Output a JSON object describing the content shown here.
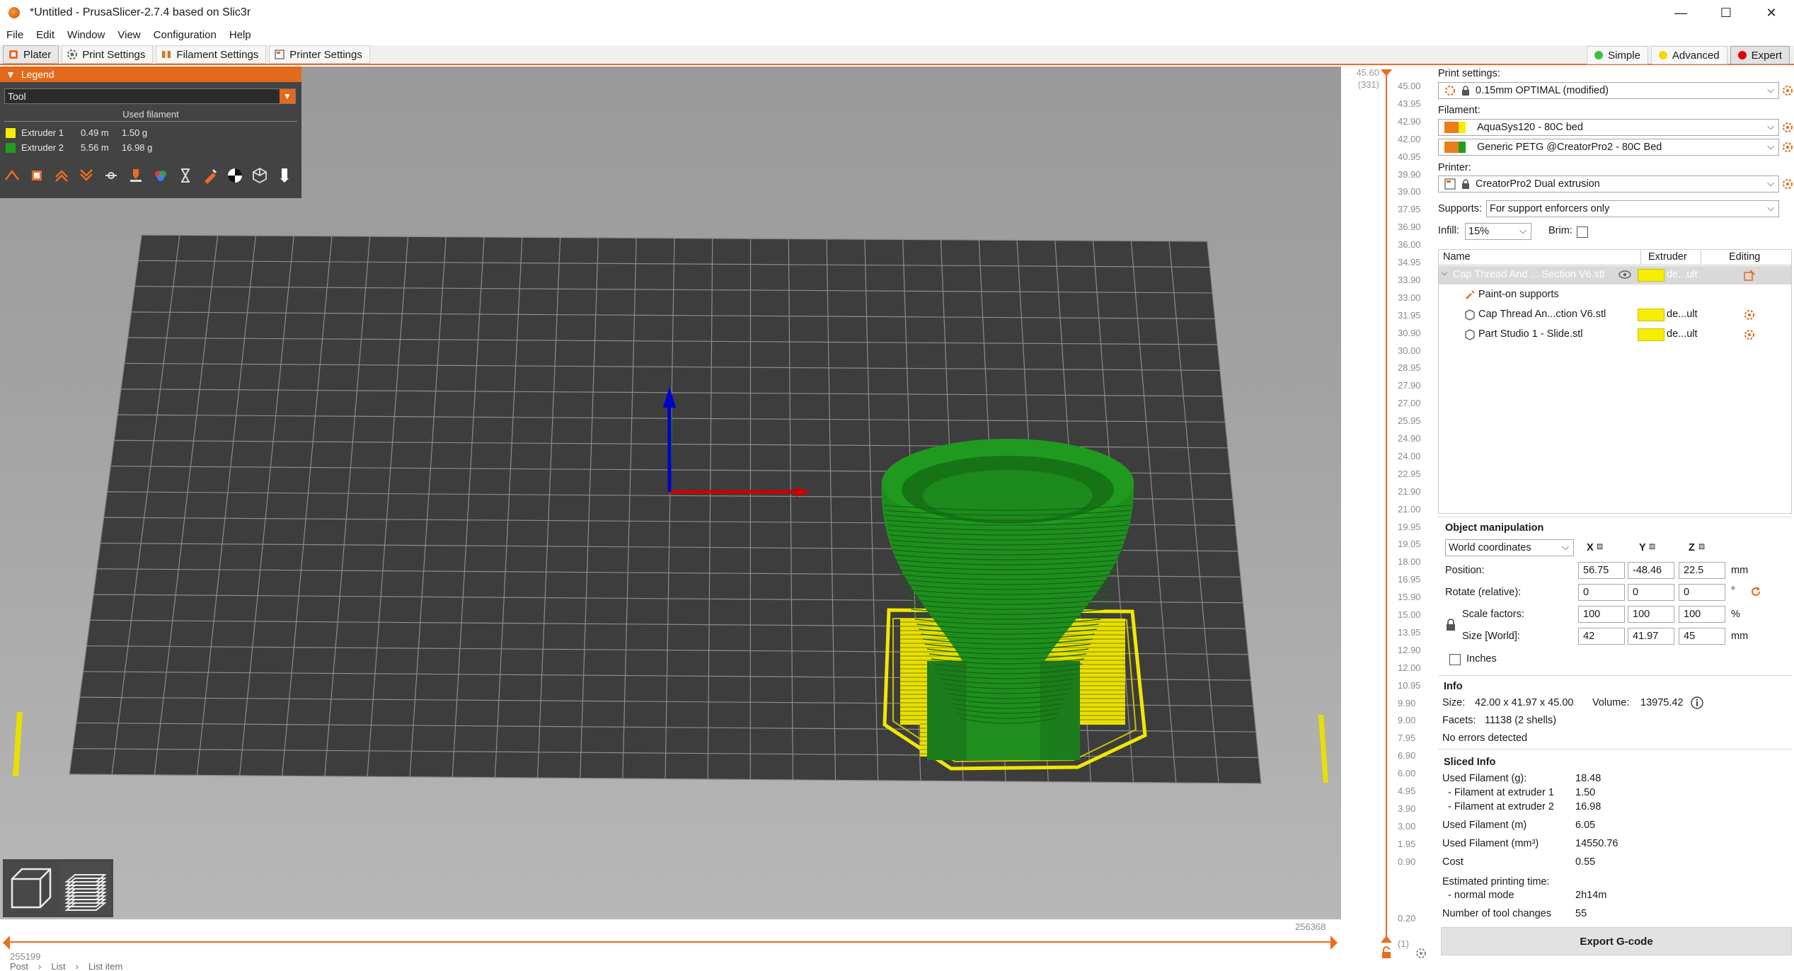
{
  "window": {
    "title": "*Untitled - PrusaSlicer-2.7.4 based on Slic3r",
    "minimize": "—",
    "maximize": "☐",
    "close": "✕"
  },
  "menu": [
    "File",
    "Edit",
    "Window",
    "View",
    "Configuration",
    "Help"
  ],
  "tabs": [
    {
      "label": "Plater",
      "active": true
    },
    {
      "label": "Print Settings"
    },
    {
      "label": "Filament Settings"
    },
    {
      "label": "Printer Settings"
    }
  ],
  "modes": [
    {
      "label": "Simple",
      "color": "#3cbf3c"
    },
    {
      "label": "Advanced",
      "color": "#f5d800"
    },
    {
      "label": "Expert",
      "color": "#e3000f",
      "active": true
    }
  ],
  "legend": {
    "title": "Legend",
    "view_type": "Tool",
    "subtitle": "Used filament",
    "rows": [
      {
        "name": "Extruder 1",
        "length": "0.49 m",
        "weight": "1.50 g",
        "color": "#f5ee00"
      },
      {
        "name": "Extruder 2",
        "length": "5.56 m",
        "weight": "16.98 g",
        "color": "#1f9e1f"
      }
    ]
  },
  "hslider": {
    "left_value": "255199",
    "right_value": "256368"
  },
  "status_path": [
    "Post",
    "List",
    "List item"
  ],
  "vslider": {
    "top_value": "45.60",
    "top_count": "(331)",
    "ticks": [
      "45.00",
      "43.95",
      "42.90",
      "42.00",
      "40.95",
      "39.90",
      "39.00",
      "37.95",
      "36.90",
      "36.00",
      "34.95",
      "33.90",
      "33.00",
      "31.95",
      "30.90",
      "30.00",
      "28.95",
      "27.90",
      "27.00",
      "25.95",
      "24.90",
      "24.00",
      "22.95",
      "21.90",
      "21.00",
      "19.95",
      "19.05",
      "18.00",
      "16.95",
      "15.90",
      "15.00",
      "13.95",
      "12.90",
      "12.00",
      "10.95",
      "9.90",
      "9.00",
      "7.95",
      "6.90",
      "6.00",
      "4.95",
      "3.90",
      "3.00",
      "1.95",
      "0.90"
    ],
    "bottom_value": "0.20",
    "bottom_count": "(1)"
  },
  "sidebar": {
    "print_settings_label": "Print settings:",
    "print_profile": "0.15mm OPTIMAL (modified)",
    "filament_label": "Filament:",
    "filament_1": "AquaSys120 - 80C bed",
    "filament_2": "Generic PETG @CreatorPro2 - 80C Bed",
    "filament_1_color": "#ed7d1a",
    "filament_2_color": "#ed7d1a",
    "printer_label": "Printer:",
    "printer_profile": "CreatorPro2 Dual extrusion",
    "supports_label": "Supports:",
    "supports_value": "For support enforcers only",
    "infill_label": "Infill:",
    "infill_value": "15%",
    "brim_label": "Brim:",
    "list_headers": {
      "name": "Name",
      "extruder": "Extruder",
      "editing": "Editing"
    },
    "list_rows": [
      {
        "name": "Cap Thread And ... Section V6.stl",
        "extruder": "de...ult"
      },
      {
        "name": "Paint-on supports",
        "extruder": ""
      },
      {
        "name": "Cap Thread An...ction V6.stl",
        "extruder": "de...ult"
      },
      {
        "name": "Part Studio 1 - Slide.stl",
        "extruder": "de...ult"
      }
    ],
    "om_title": "Object manipulation",
    "om_coords": "World coordinates",
    "om_axes": [
      "X",
      "Y",
      "Z"
    ],
    "om_position_label": "Position:",
    "om_position": [
      "56.75",
      "-48.46",
      "22.5"
    ],
    "om_position_unit": "mm",
    "om_rotate_label": "Rotate (relative):",
    "om_rotate": [
      "0",
      "0",
      "0"
    ],
    "om_rotate_unit": "°",
    "om_scale_label": "Scale factors:",
    "om_scale": [
      "100",
      "100",
      "100"
    ],
    "om_scale_unit": "%",
    "om_size_label": "Size [World]:",
    "om_size": [
      "42",
      "41.97",
      "45"
    ],
    "om_size_unit": "mm",
    "om_inches": "Inches",
    "info_title": "Info",
    "info_size_label": "Size:",
    "info_size": "42.00 x 41.97 x 45.00",
    "info_volume_label": "Volume:",
    "info_volume": "13975.42",
    "info_facets_label": "Facets:",
    "info_facets": "11138 (2 shells)",
    "info_errors": "No errors detected",
    "sliced_title": "Sliced Info",
    "sliced_rows": [
      {
        "label": "Used Filament (g):",
        "value": "18.48"
      },
      {
        "label": "  - Filament at extruder 1",
        "value": "1.50"
      },
      {
        "label": "  - Filament at extruder 2",
        "value": "16.98"
      },
      {
        "label": "Used Filament (m)",
        "value": "6.05"
      },
      {
        "label": "Used Filament (mm³)",
        "value": "14550.76"
      },
      {
        "label": "Cost",
        "value": "0.55"
      },
      {
        "label": "Estimated printing time:",
        "value": ""
      },
      {
        "label": "  - normal mode",
        "value": "2h14m"
      },
      {
        "label": "Number of tool changes",
        "value": "55"
      }
    ],
    "export_label": "Export G-code"
  }
}
